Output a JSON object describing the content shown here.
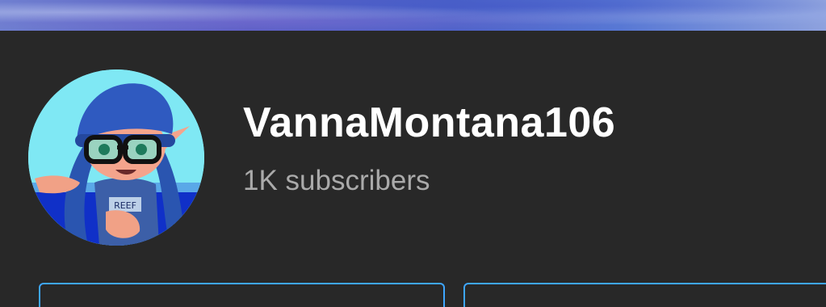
{
  "channel": {
    "name": "VannaMontana106",
    "subscribers": "1K subscribers"
  },
  "avatar": {
    "shirt_text": "REEF"
  },
  "colors": {
    "background": "#282828",
    "name_text": "#ffffff",
    "subscriber_text": "#aaaaaa",
    "button_border": "#3ea6ff"
  }
}
